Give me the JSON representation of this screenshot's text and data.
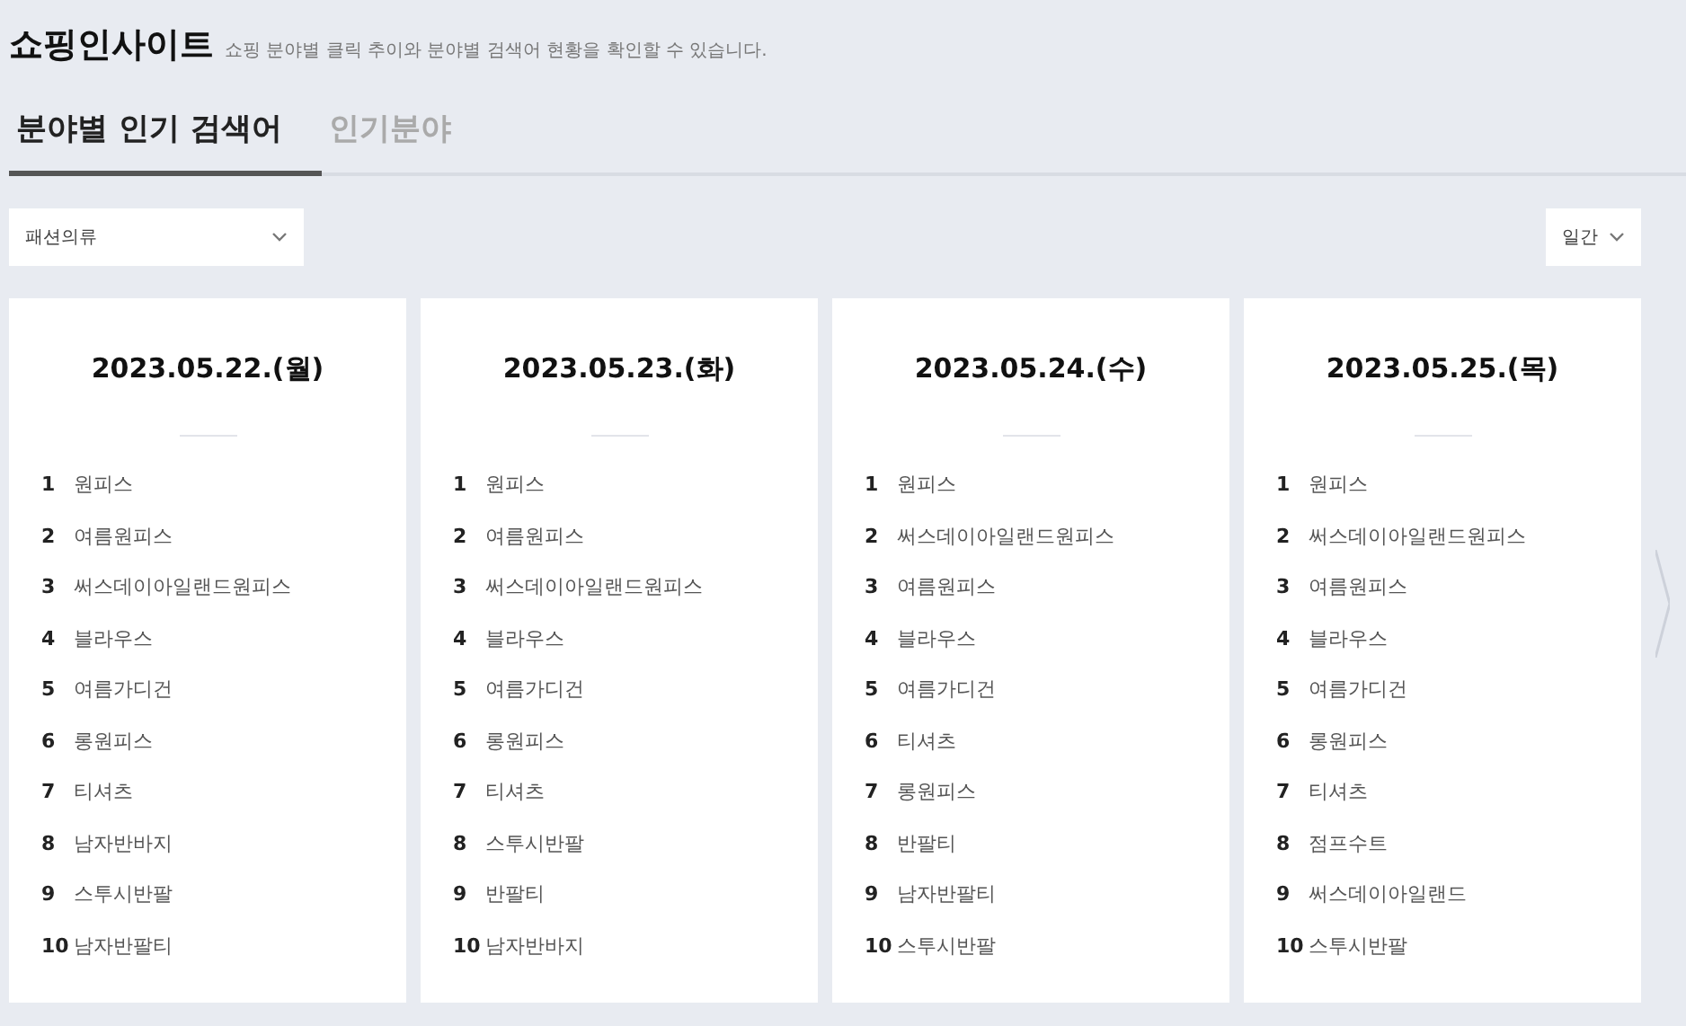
{
  "header": {
    "title": "쇼핑인사이트",
    "subtitle": "쇼핑 분야별 클릭 추이와 분야별 검색어 현황을 확인할 수 있습니다."
  },
  "tabs": [
    {
      "label": "분야별 인기 검색어",
      "selected": true
    },
    {
      "label": "인기분야",
      "selected": false
    }
  ],
  "category_select": {
    "value": "패션의류"
  },
  "period_select": {
    "value": "일간"
  },
  "days": [
    {
      "date": "2023.05.22.(월)",
      "keywords": [
        {
          "rank": "1",
          "term": "원피스"
        },
        {
          "rank": "2",
          "term": "여름원피스"
        },
        {
          "rank": "3",
          "term": "써스데이아일랜드원피스"
        },
        {
          "rank": "4",
          "term": "블라우스"
        },
        {
          "rank": "5",
          "term": "여름가디건"
        },
        {
          "rank": "6",
          "term": "롱원피스"
        },
        {
          "rank": "7",
          "term": "티셔츠"
        },
        {
          "rank": "8",
          "term": "남자반바지"
        },
        {
          "rank": "9",
          "term": "스투시반팔"
        },
        {
          "rank": "10",
          "term": "남자반팔티"
        }
      ]
    },
    {
      "date": "2023.05.23.(화)",
      "keywords": [
        {
          "rank": "1",
          "term": "원피스"
        },
        {
          "rank": "2",
          "term": "여름원피스"
        },
        {
          "rank": "3",
          "term": "써스데이아일랜드원피스"
        },
        {
          "rank": "4",
          "term": "블라우스"
        },
        {
          "rank": "5",
          "term": "여름가디건"
        },
        {
          "rank": "6",
          "term": "롱원피스"
        },
        {
          "rank": "7",
          "term": "티셔츠"
        },
        {
          "rank": "8",
          "term": "스투시반팔"
        },
        {
          "rank": "9",
          "term": "반팔티"
        },
        {
          "rank": "10",
          "term": "남자반바지"
        }
      ]
    },
    {
      "date": "2023.05.24.(수)",
      "keywords": [
        {
          "rank": "1",
          "term": "원피스"
        },
        {
          "rank": "2",
          "term": "써스데이아일랜드원피스"
        },
        {
          "rank": "3",
          "term": "여름원피스"
        },
        {
          "rank": "4",
          "term": "블라우스"
        },
        {
          "rank": "5",
          "term": "여름가디건"
        },
        {
          "rank": "6",
          "term": "티셔츠"
        },
        {
          "rank": "7",
          "term": "롱원피스"
        },
        {
          "rank": "8",
          "term": "반팔티"
        },
        {
          "rank": "9",
          "term": "남자반팔티"
        },
        {
          "rank": "10",
          "term": "스투시반팔"
        }
      ]
    },
    {
      "date": "2023.05.25.(목)",
      "keywords": [
        {
          "rank": "1",
          "term": "원피스"
        },
        {
          "rank": "2",
          "term": "써스데이아일랜드원피스"
        },
        {
          "rank": "3",
          "term": "여름원피스"
        },
        {
          "rank": "4",
          "term": "블라우스"
        },
        {
          "rank": "5",
          "term": "여름가디건"
        },
        {
          "rank": "6",
          "term": "롱원피스"
        },
        {
          "rank": "7",
          "term": "티셔츠"
        },
        {
          "rank": "8",
          "term": "점프수트"
        },
        {
          "rank": "9",
          "term": "써스데이아일랜드"
        },
        {
          "rank": "10",
          "term": "스투시반팔"
        }
      ]
    }
  ]
}
